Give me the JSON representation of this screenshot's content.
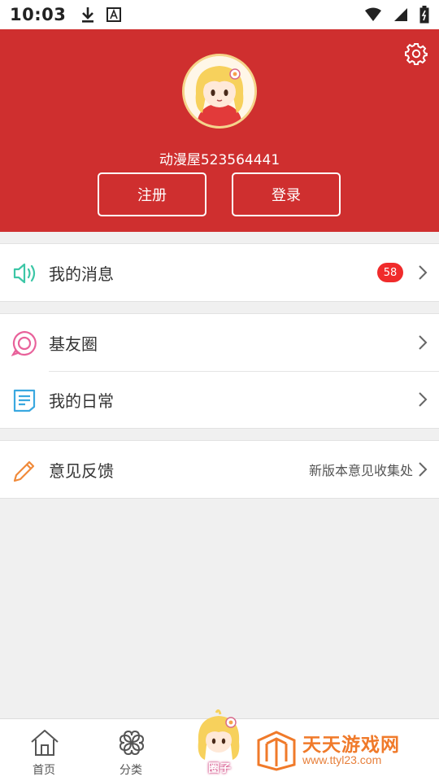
{
  "status_bar": {
    "time": "10:03"
  },
  "header": {
    "username": "动漫屋523564441",
    "register_label": "注册",
    "login_label": "登录",
    "bg_color": "#cf2f2f"
  },
  "menu": {
    "messages": {
      "label": "我的消息",
      "badge": "58"
    },
    "friends": {
      "label": "基友圈"
    },
    "daily": {
      "label": "我的日常"
    },
    "feedback": {
      "label": "意见反馈",
      "hint": "新版本意见收集处"
    }
  },
  "bottom_nav": {
    "home": "首页",
    "category": "分类",
    "circle": "圈子"
  },
  "watermark": {
    "title": "天天游戏网",
    "url": "www.ttyl23.com"
  },
  "icons": {
    "settings": "gear-icon",
    "messages": "speaker-icon",
    "friends": "chat-bubble-icon",
    "daily": "note-icon",
    "feedback": "pencil-icon"
  }
}
